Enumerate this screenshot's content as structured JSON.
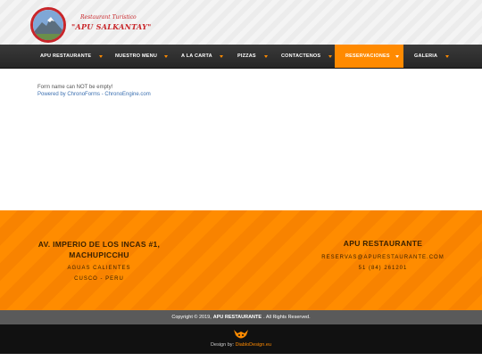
{
  "header": {
    "logo_small": "Restaurant Turístico",
    "logo_big": "\"APU SALKANTAY\""
  },
  "nav": {
    "items": [
      {
        "label": "APU RESTAURANTE",
        "has_dropdown": true
      },
      {
        "label": "NUESTRO MENU",
        "has_dropdown": true
      },
      {
        "label": "A LA CARTA",
        "has_dropdown": true
      },
      {
        "label": "PIZZAS",
        "has_dropdown": true
      },
      {
        "label": "CONTACTENOS",
        "has_dropdown": true
      },
      {
        "label": "RESERVACIONES",
        "has_dropdown": true,
        "active": true
      },
      {
        "label": "GALERIA",
        "has_dropdown": true
      }
    ],
    "accent_color": "#ff8a00"
  },
  "content": {
    "error_message": "Form name can NOT be empty!",
    "powered_by": "Powered by ChronoForms - ChronoEngine.com"
  },
  "footer": {
    "left": {
      "title_line1": "AV. IMPERIO DE LOS INCAS #1,",
      "title_line2": "MACHUPICCHU",
      "line1": "AGUAS CALIENTES",
      "line2": "CUSCO - PERU"
    },
    "right": {
      "title": "APU RESTAURANTE",
      "email": "RESERVAS@APURESTAURANTE.COM",
      "phone": "51 (84) 261201"
    },
    "background_color": "#ff8c00"
  },
  "copyright": {
    "prefix": "Copyright © 2019,",
    "brand": "APU RESTAURANTE",
    "suffix": ". All Rights Reserved."
  },
  "design": {
    "label": "Design by:",
    "link": "DiabloDesign.eu"
  }
}
